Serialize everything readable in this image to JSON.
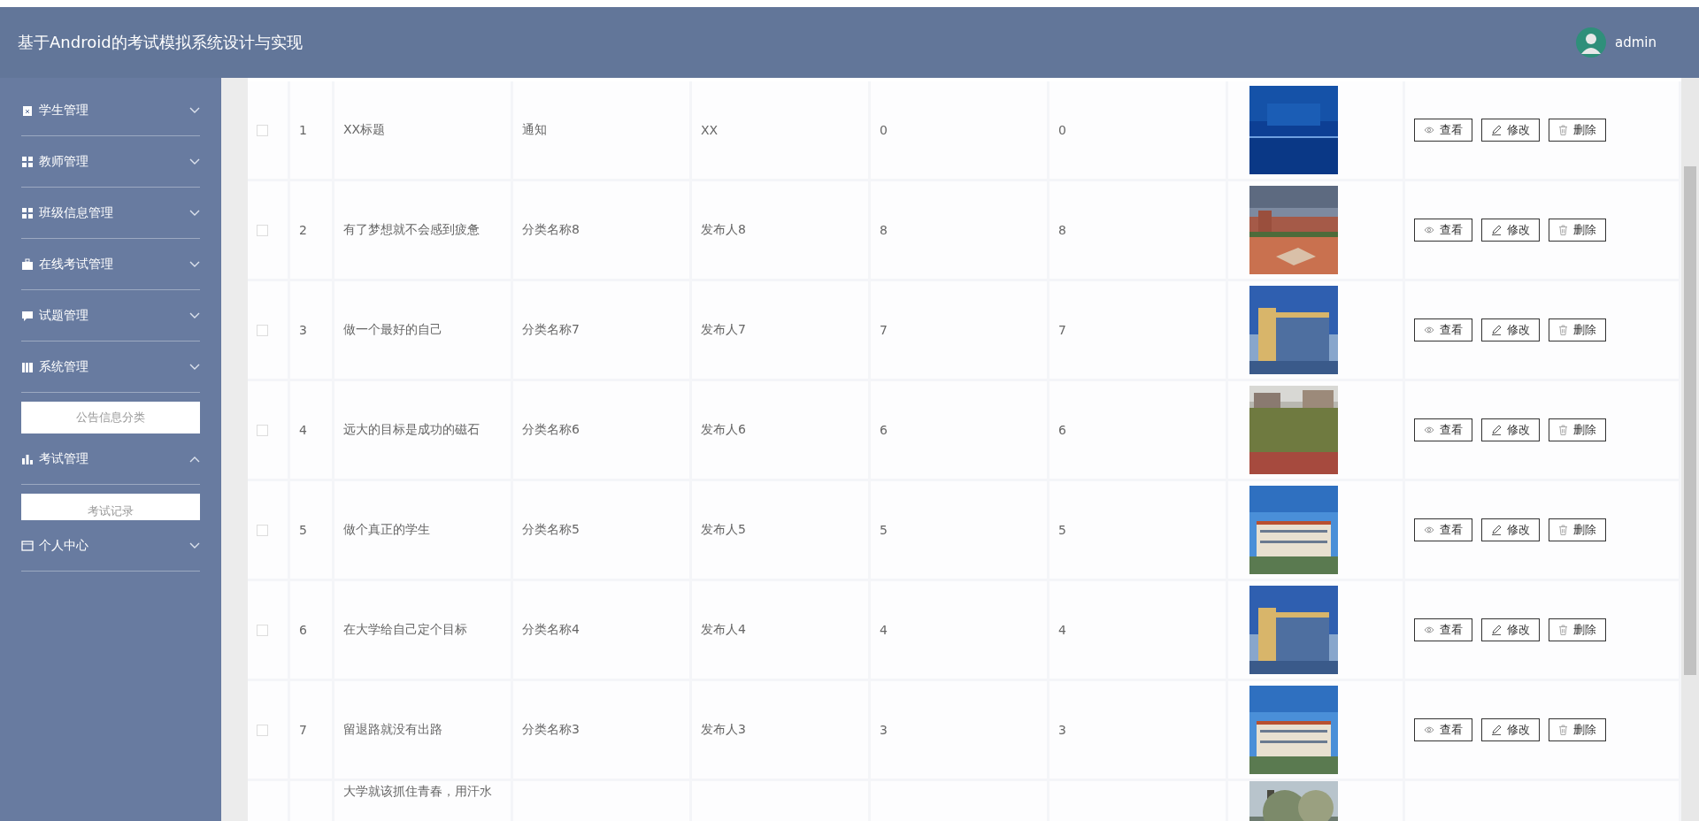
{
  "header": {
    "title": "基于Android的考试模拟系统设计与实现",
    "user": "admin"
  },
  "sidebar": {
    "items": [
      {
        "label": "学生管理",
        "expanded": false
      },
      {
        "label": "教师管理",
        "expanded": false
      },
      {
        "label": "班级信息管理",
        "expanded": false
      },
      {
        "label": "在线考试管理",
        "expanded": false
      },
      {
        "label": "试题管理",
        "expanded": false
      },
      {
        "label": "系统管理",
        "expanded": false,
        "children": [
          {
            "label": "公告信息分类"
          }
        ]
      },
      {
        "label": "考试管理",
        "expanded": true,
        "children": [
          {
            "label": "考试记录"
          }
        ]
      },
      {
        "label": "个人中心",
        "expanded": false
      }
    ]
  },
  "table": {
    "rows": [
      {
        "checked": false,
        "index": "1",
        "title": "XX标题",
        "category": "通知",
        "publisher": "XX",
        "column_5": "0",
        "column_6": "0",
        "actions": [
          "查看",
          "修改",
          "删除"
        ]
      },
      {
        "checked": false,
        "index": "2",
        "title": "有了梦想就不会感到疲惫",
        "category": "分类名称8",
        "publisher": "发布人8",
        "column_5": "8",
        "column_6": "8",
        "actions": [
          "查看",
          "修改",
          "删除"
        ]
      },
      {
        "checked": false,
        "index": "3",
        "title": "做一个最好的自己",
        "category": "分类名称7",
        "publisher": "发布人7",
        "column_5": "7",
        "column_6": "7",
        "actions": [
          "查看",
          "修改",
          "删除"
        ]
      },
      {
        "checked": false,
        "index": "4",
        "title": "远大的目标是成功的磁石",
        "category": "分类名称6",
        "publisher": "发布人6",
        "column_5": "6",
        "column_6": "6",
        "actions": [
          "查看",
          "修改",
          "删除"
        ]
      },
      {
        "checked": false,
        "index": "5",
        "title": "做个真正的学生",
        "category": "分类名称5",
        "publisher": "发布人5",
        "column_5": "5",
        "column_6": "5",
        "actions": [
          "查看",
          "修改",
          "删除"
        ]
      },
      {
        "checked": false,
        "index": "6",
        "title": "在大学给自己定个目标",
        "category": "分类名称4",
        "publisher": "发布人4",
        "column_5": "4",
        "column_6": "4",
        "actions": [
          "查看",
          "修改",
          "删除"
        ]
      },
      {
        "checked": false,
        "index": "7",
        "title": "留退路就没有出路",
        "category": "分类名称3",
        "publisher": "发布人3",
        "column_5": "3",
        "column_6": "3",
        "actions": [
          "查看",
          "修改",
          "删除"
        ]
      },
      {
        "title": "大学就该抓住青春，用汗水"
      }
    ]
  }
}
